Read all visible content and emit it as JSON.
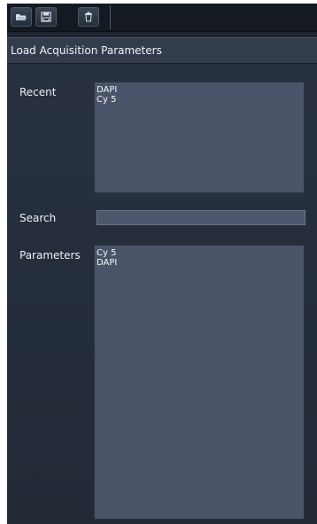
{
  "toolbar": {
    "buttons": [
      {
        "icon": "folder-open-icon"
      },
      {
        "icon": "save-icon"
      },
      {
        "icon": "delete-icon"
      }
    ]
  },
  "panel": {
    "title": "Load Acquisition Parameters",
    "recent": {
      "label": "Recent",
      "items": [
        "DAPI",
        "Cy 5"
      ]
    },
    "search": {
      "label": "Search",
      "value": "",
      "placeholder": ""
    },
    "parameters": {
      "label": "Parameters",
      "items": [
        "Cy 5",
        "DAPI"
      ]
    }
  },
  "colors": {
    "background": "#1e2530",
    "toolbar": "#141a22",
    "title_bar": "#323c4c",
    "panel": "#283140",
    "listbox": "#4a5468",
    "text": "#e6ebf2"
  }
}
